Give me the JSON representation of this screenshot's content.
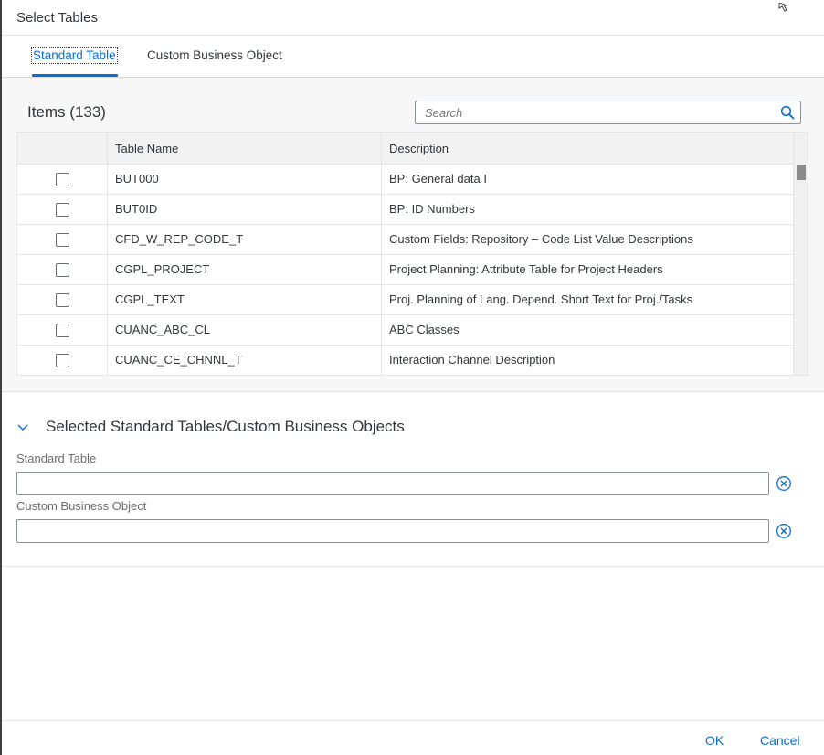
{
  "dialog": {
    "title": "Select Tables"
  },
  "tabs": [
    {
      "label": "Standard Table",
      "selected": true
    },
    {
      "label": "Custom Business Object",
      "selected": false
    }
  ],
  "list": {
    "title": "Items (133)",
    "search_placeholder": "Search",
    "columns": [
      "Table Name",
      "Description"
    ],
    "rows": [
      {
        "name": "BUT000",
        "description": "BP: General data I"
      },
      {
        "name": "BUT0ID",
        "description": "BP: ID Numbers"
      },
      {
        "name": "CFD_W_REP_CODE_T",
        "description": "Custom Fields: Repository – Code List Value Descriptions"
      },
      {
        "name": "CGPL_PROJECT",
        "description": "Project Planning: Attribute Table for Project Headers"
      },
      {
        "name": "CGPL_TEXT",
        "description": "Proj. Planning of Lang. Depend. Short Text for Proj./Tasks"
      },
      {
        "name": "CUANC_ABC_CL",
        "description": "ABC Classes"
      },
      {
        "name": "CUANC_CE_CHNNL_T",
        "description": "Interaction Channel Description"
      }
    ]
  },
  "selected_section": {
    "title": "Selected Standard Tables/Custom Business Objects",
    "standard_table_label": "Standard Table",
    "standard_table_value": "",
    "custom_bo_label": "Custom Business Object",
    "custom_bo_value": ""
  },
  "footer": {
    "ok_label": "OK",
    "cancel_label": "Cancel"
  },
  "colors": {
    "accent": "#0a6ed1",
    "text": "#32363a",
    "label": "#6a6d70"
  }
}
